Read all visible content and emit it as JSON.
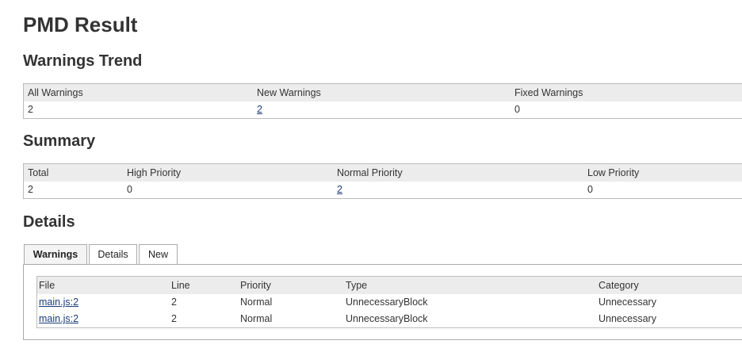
{
  "title": "PMD Result",
  "trend": {
    "heading": "Warnings Trend",
    "headers": [
      "All Warnings",
      "New Warnings",
      "Fixed Warnings"
    ],
    "values": [
      "2",
      "2",
      "0"
    ]
  },
  "summary": {
    "heading": "Summary",
    "headers": [
      "Total",
      "High Priority",
      "Normal Priority",
      "Low Priority"
    ],
    "values": [
      "2",
      "0",
      "2",
      "0"
    ]
  },
  "details": {
    "heading": "Details",
    "tabs": [
      {
        "label": "Warnings",
        "active": true
      },
      {
        "label": "Details",
        "active": false
      },
      {
        "label": "New",
        "active": false
      }
    ],
    "table": {
      "headers": [
        "File",
        "Line",
        "Priority",
        "Type",
        "Category"
      ],
      "rows": [
        {
          "file": "main.js:2",
          "line": "2",
          "priority": "Normal",
          "type": "UnnecessaryBlock",
          "category": "Unnecessary"
        },
        {
          "file": "main.js:2",
          "line": "2",
          "priority": "Normal",
          "type": "UnnecessaryBlock",
          "category": "Unnecessary"
        }
      ]
    }
  },
  "colors": {
    "header_bg": "#ececec",
    "link": "#1a3c7a",
    "border": "#bbbbbb"
  }
}
